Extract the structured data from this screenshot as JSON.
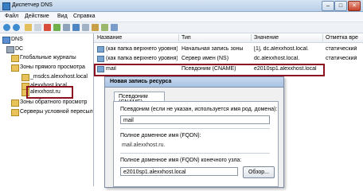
{
  "window": {
    "title": "Диспетчер DNS"
  },
  "menu": {
    "items": [
      "Файл",
      "Действие",
      "Вид",
      "Справка"
    ]
  },
  "tree": {
    "root": "DNS",
    "dc": "DC",
    "global_logs": "Глобальные журналы",
    "forward_zones": "Зоны прямого просмотра",
    "msdcs": "_msdcs.alexxhost.local",
    "alexxhost_local": "alexxhost.local",
    "alexxhost_ru": "alexxhost.ru",
    "reverse_zones": "Зоны обратного просмотр",
    "conditional": "Серверы условной пересыл"
  },
  "list": {
    "headers": [
      "Название",
      "Тип",
      "Значение",
      "Отметка вре"
    ],
    "rows": [
      [
        "(как папка верхнего уровня)",
        "Начальная запись зоны",
        "[1], dc.alexxhost.local.",
        "статический"
      ],
      [
        "(как папка верхнего уровня)",
        "Сервер имен (NS)",
        "dc.alexxhost.local.",
        "статический"
      ],
      [
        "mail",
        "Псевдоним (CNAME)",
        "e2010sp1.alexxhost.local",
        ""
      ]
    ]
  },
  "dialog": {
    "title": "Новая запись ресурса",
    "tab": "Псевдоним (CNAME)",
    "alias_label": "Псевдоним (если не указан, используется имя род. домена):",
    "alias_value": "mail",
    "fqdn_label": "Полное доменное имя (FQDN):",
    "fqdn_value": "mail.alexxhost.ru.",
    "target_label": "Полное доменное имя (FQDN) конечного узла:",
    "target_value": "e2010sp1.alexxhost.local",
    "browse_label": "Обзор..."
  }
}
